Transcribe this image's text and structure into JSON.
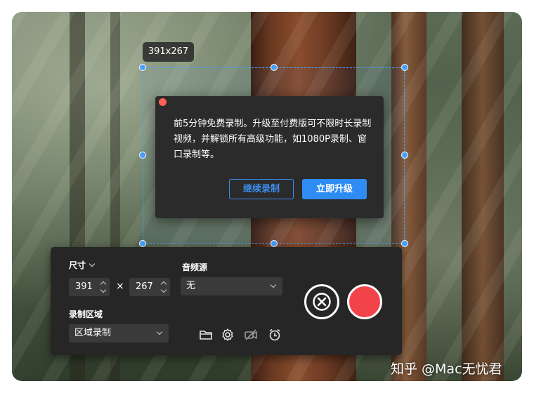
{
  "selection": {
    "size_label": "391x267"
  },
  "dialog": {
    "message": "前5分钟免费录制。升级至付费版可不限时长录制视频，并解锁所有高级功能，如1080P录制、窗口录制等。",
    "continue_label": "继续录制",
    "upgrade_label": "立即升级"
  },
  "panel": {
    "size_label": "尺寸",
    "width_value": "391",
    "times_sign": "×",
    "height_value": "267",
    "audio_label": "音频源",
    "audio_value": "无",
    "region_label": "录制区域",
    "region_value": "区域录制",
    "icons": [
      "folder-icon",
      "gear-icon",
      "camera-off-icon",
      "alarm-clock-icon"
    ]
  },
  "watermark": "知乎 @Mac无忧君",
  "colors": {
    "accent": "#2f8cf5",
    "record": "#f3434a",
    "close_dot": "#ff5f57",
    "selection": "#4aa0ff"
  }
}
